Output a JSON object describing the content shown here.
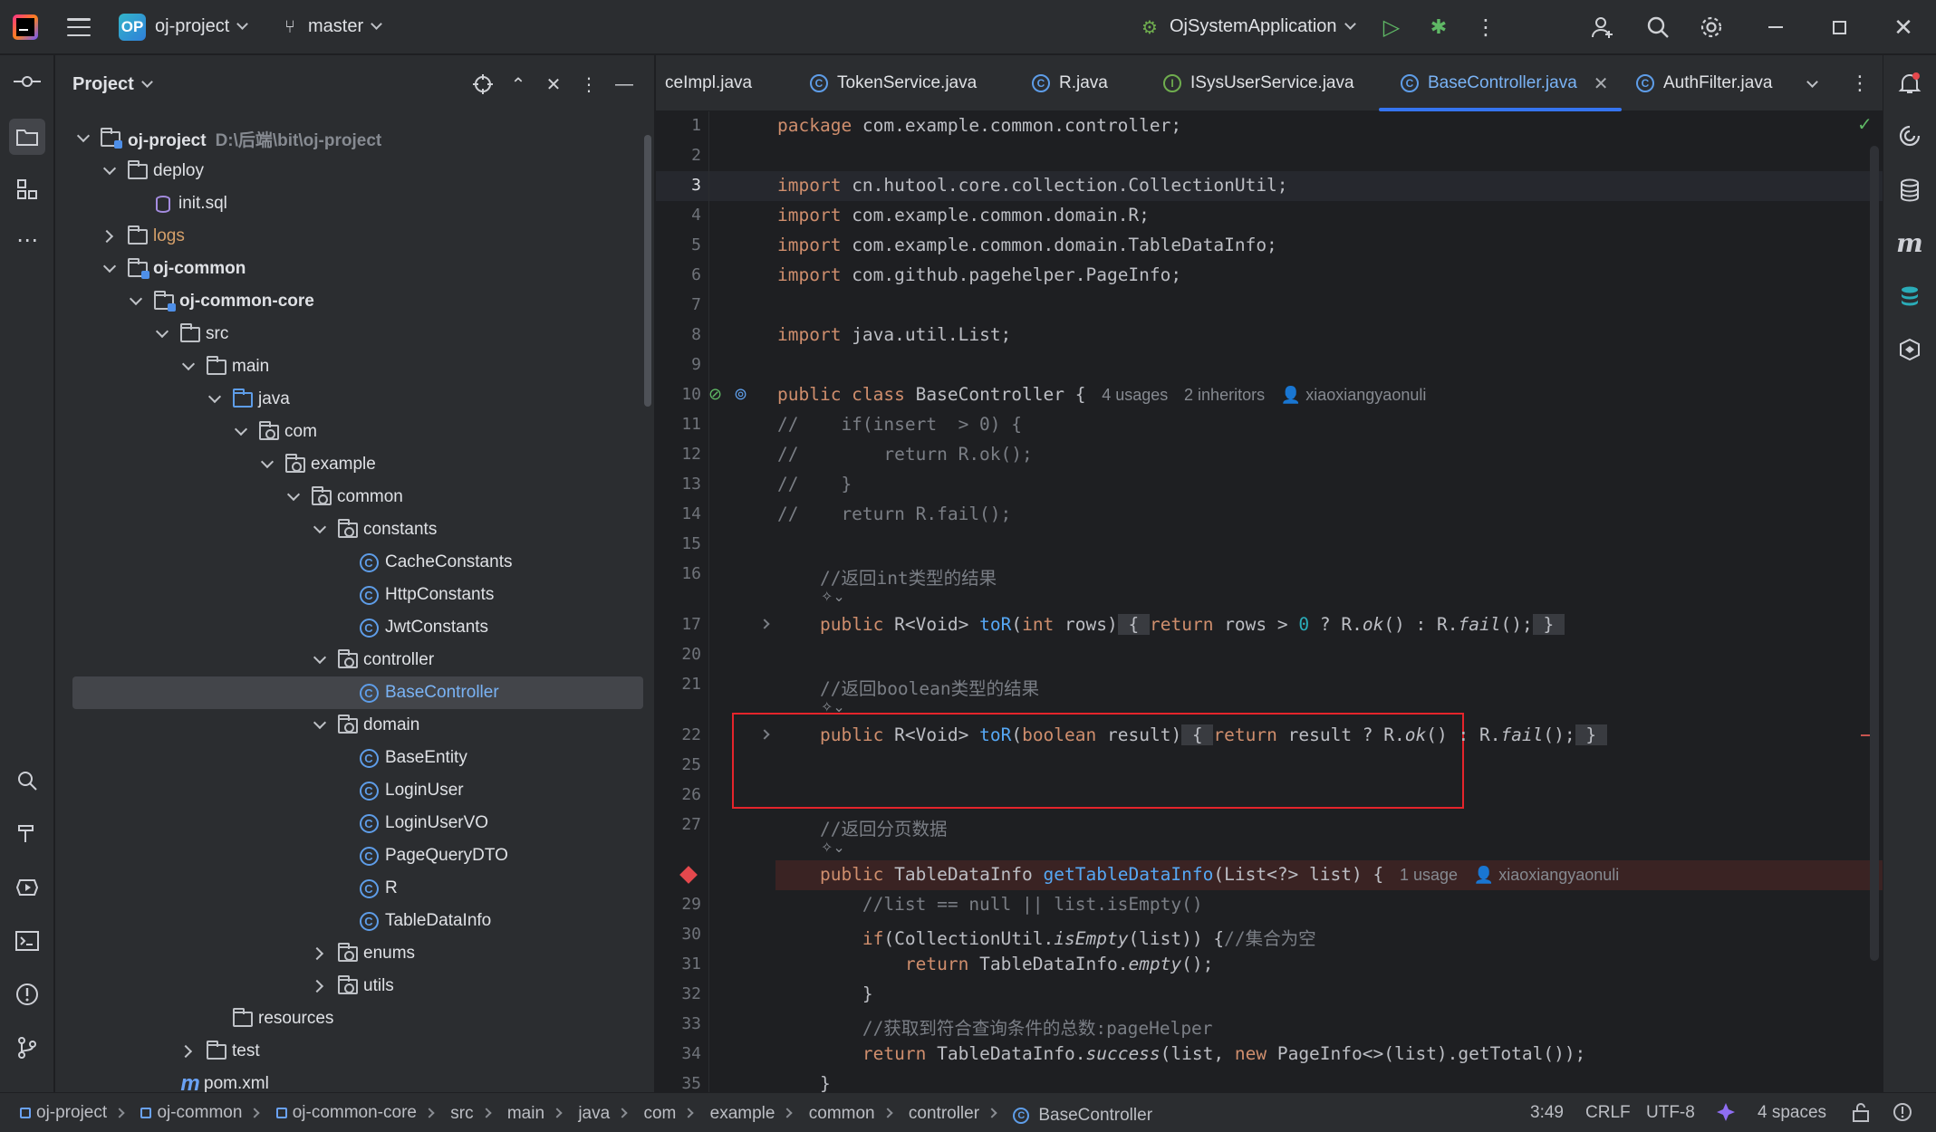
{
  "titlebar": {
    "project_badge": "OP",
    "project_name": "oj-project",
    "branch": "master",
    "run_config": "OjSystemApplication"
  },
  "project_panel": {
    "title": "Project",
    "tree": [
      {
        "label": "oj-project",
        "path": "D:\\后端\\bit\\oj-project",
        "bold": true
      },
      {
        "label": "deploy"
      },
      {
        "label": "init.sql"
      },
      {
        "label": "logs"
      },
      {
        "label": "oj-common",
        "bold": true
      },
      {
        "label": "oj-common-core",
        "bold": true
      },
      {
        "label": "src"
      },
      {
        "label": "main"
      },
      {
        "label": "java"
      },
      {
        "label": "com"
      },
      {
        "label": "example"
      },
      {
        "label": "common"
      },
      {
        "label": "constants"
      },
      {
        "label": "CacheConstants"
      },
      {
        "label": "HttpConstants"
      },
      {
        "label": "JwtConstants"
      },
      {
        "label": "controller"
      },
      {
        "label": "BaseController"
      },
      {
        "label": "domain"
      },
      {
        "label": "BaseEntity"
      },
      {
        "label": "LoginUser"
      },
      {
        "label": "LoginUserVO"
      },
      {
        "label": "PageQueryDTO"
      },
      {
        "label": "R"
      },
      {
        "label": "TableDataInfo"
      },
      {
        "label": "enums"
      },
      {
        "label": "utils"
      },
      {
        "label": "resources"
      },
      {
        "label": "test"
      },
      {
        "label": "pom.xml"
      }
    ]
  },
  "tabs": [
    {
      "label": "ceImpl.java"
    },
    {
      "label": "TokenService.java"
    },
    {
      "label": "R.java"
    },
    {
      "label": "ISysUserService.java"
    },
    {
      "label": "BaseController.java"
    },
    {
      "label": "AuthFilter.java"
    }
  ],
  "code": {
    "hints": {
      "class_usages": "4 usages",
      "class_inheritors": "2 inheritors",
      "author": "xiaoxiangyaonuli",
      "method_usage": "1 usage"
    },
    "line_numbers": [
      "1",
      "2",
      "3",
      "4",
      "5",
      "6",
      "7",
      "8",
      "9",
      "10",
      "11",
      "12",
      "13",
      "14",
      "15",
      "16",
      "17",
      "20",
      "21",
      "22",
      "25",
      "26",
      "27",
      "28",
      "29",
      "30",
      "31",
      "32",
      "33",
      "34",
      "35"
    ],
    "comments": {
      "c16": "//返回int类型的结果",
      "c21": "//返回boolean类型的结果",
      "c27": "//返回分页数据",
      "c29": "//list == null || list.isEmpty()",
      "c30": "//集合为空",
      "c33": "//获取到符合查询条件的总数:pageHelper"
    }
  },
  "statusbar": {
    "breadcrumbs": [
      "oj-project",
      "oj-common",
      "oj-common-core",
      "src",
      "main",
      "java",
      "com",
      "example",
      "common",
      "controller",
      "BaseController"
    ],
    "position": "3:49",
    "line_sep": "CRLF",
    "encoding": "UTF-8",
    "indent": "4 spaces"
  }
}
